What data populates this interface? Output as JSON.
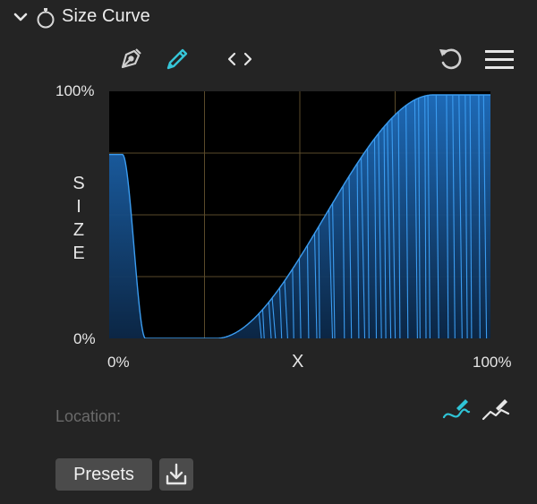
{
  "panel": {
    "title": "Size Curve",
    "collapse_icon": "chevron-down-icon",
    "title_icon": "stopwatch-icon"
  },
  "toolbar": {
    "tools": [
      "pen-tool-icon",
      "pencil-tool-icon",
      "code-brackets-icon"
    ],
    "actions": [
      "reset-icon",
      "hamburger-menu-icon"
    ],
    "active_tool": "pencil-tool-icon"
  },
  "graph": {
    "y_max_label": "100%",
    "y_min_label": "0%",
    "y_axis_label": "SIZE",
    "x_min_label": "0%",
    "x_axis_label": "X",
    "x_max_label": "100%",
    "curve_color": "#2f8fe0",
    "grid_color": "#5a4a2a"
  },
  "location": {
    "label": "Location:",
    "icons": [
      "draw-curve-active-icon",
      "draw-line-icon"
    ],
    "active_color": "#2fc4d6"
  },
  "footer": {
    "presets_label": "Presets",
    "download_icon": "download-icon"
  }
}
